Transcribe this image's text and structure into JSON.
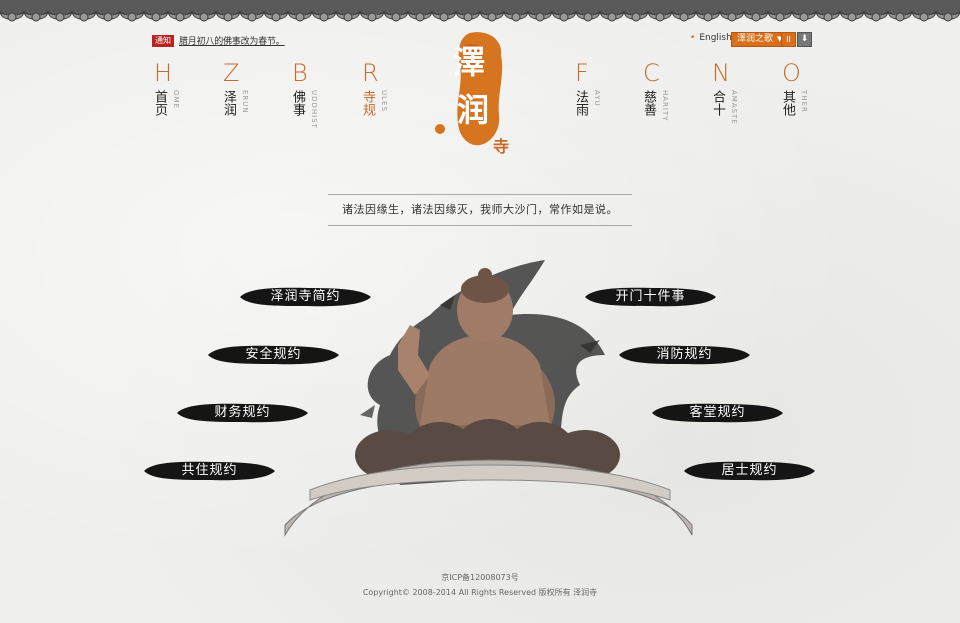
{
  "notice": {
    "badge": "通知",
    "text": "腊月初八的佛事改为春节。"
  },
  "toolbar": {
    "english": "English",
    "music_label": "澤润之歌",
    "music_arrow": "▼",
    "pause": "II",
    "download": "⬇"
  },
  "logo": {
    "char1": "澤",
    "char2": "润",
    "char3": "寺"
  },
  "nav": [
    {
      "letter": "H",
      "cn": "首页",
      "en": "OME"
    },
    {
      "letter": "Z",
      "cn": "泽润",
      "en": "ERUN"
    },
    {
      "letter": "B",
      "cn": "佛事",
      "en": "UDDHIST"
    },
    {
      "letter": "R",
      "cn": "寺规",
      "en": "ULES"
    },
    {
      "letter": "F",
      "cn": "法雨",
      "en": "AYU"
    },
    {
      "letter": "C",
      "cn": "慈善",
      "en": "HARITY"
    },
    {
      "letter": "N",
      "cn": "合十",
      "en": "AMASTE"
    },
    {
      "letter": "O",
      "cn": "其他",
      "en": "THER"
    }
  ],
  "motto": "诸法因缘生，诸法因缘灭，我师大沙门，常作如是说。",
  "rules_left": [
    "泽润寺简约",
    "安全规约",
    "财务规约",
    "共住规约"
  ],
  "rules_right": [
    "开门十件事",
    "消防规约",
    "客堂规约",
    "居士规约"
  ],
  "footer": {
    "icp": "京ICP备12008073号",
    "copyright": "Copyright© 2008-2014 All Rights Reserved 版权所有 泽润寺"
  },
  "colors": {
    "accent": "#d96f1b",
    "ink": "#1a1a1a",
    "badge": "#b8221f"
  }
}
